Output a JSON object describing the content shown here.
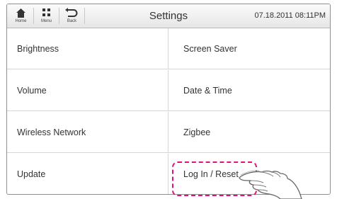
{
  "header": {
    "nav": [
      {
        "label": "Home",
        "icon": "home-icon"
      },
      {
        "label": "Menu",
        "icon": "menu-grid-icon"
      },
      {
        "label": "Back",
        "icon": "back-icon"
      }
    ],
    "title": "Settings",
    "datetime": "07.18.2011 08:11PM"
  },
  "settings": {
    "rows": [
      {
        "left": "Brightness",
        "right": "Screen Saver"
      },
      {
        "left": "Volume",
        "right": "Date & Time"
      },
      {
        "left": "Wireless Network",
        "right": "Zigbee"
      },
      {
        "left": "Update",
        "right": "Log In / Reset"
      }
    ]
  },
  "colors": {
    "highlight": "#e0117f"
  }
}
